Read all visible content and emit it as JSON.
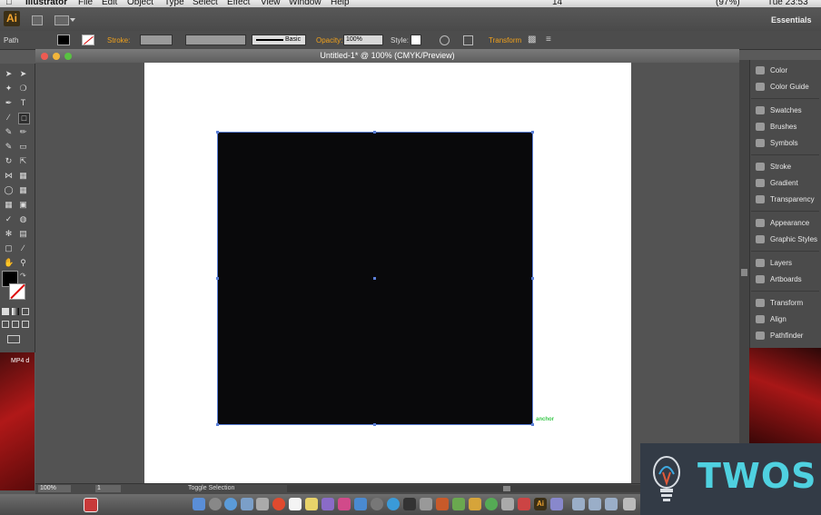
{
  "menubar": {
    "app_name": "Illustrator",
    "items": [
      "File",
      "Edit",
      "Object",
      "Type",
      "Select",
      "Effect",
      "View",
      "Window",
      "Help"
    ],
    "status": "14",
    "battery": "(97%)",
    "clock": "Tue 23:53"
  },
  "appbar": {
    "logo": "Ai",
    "workspace": "Essentials"
  },
  "control": {
    "selection_label": "Path",
    "stroke_label": "Stroke:",
    "brush_label": "Basic",
    "opacity_label": "Opacity:",
    "opacity_value": "100%",
    "style_label": "Style:",
    "transform_label": "Transform"
  },
  "document": {
    "title": "Untitled-1* @ 100% (CMYK/Preview)",
    "anchor_label": "anchor"
  },
  "statusbar": {
    "zoom": "100%",
    "page": "1",
    "toggle": "Toggle Selection"
  },
  "panels": [
    {
      "label": "Color",
      "icon": "color-icon"
    },
    {
      "label": "Color Guide",
      "icon": "color-guide-icon"
    },
    {
      "label": "Swatches",
      "icon": "swatches-icon"
    },
    {
      "label": "Brushes",
      "icon": "brushes-icon"
    },
    {
      "label": "Symbols",
      "icon": "symbols-icon"
    },
    {
      "label": "Stroke",
      "icon": "stroke-icon"
    },
    {
      "label": "Gradient",
      "icon": "gradient-icon"
    },
    {
      "label": "Transparency",
      "icon": "transparency-icon"
    },
    {
      "label": "Appearance",
      "icon": "appearance-icon"
    },
    {
      "label": "Graphic Styles",
      "icon": "graphic-styles-icon"
    },
    {
      "label": "Layers",
      "icon": "layers-icon"
    },
    {
      "label": "Artboards",
      "icon": "artboards-icon"
    },
    {
      "label": "Transform",
      "icon": "transform-icon"
    },
    {
      "label": "Align",
      "icon": "align-icon"
    },
    {
      "label": "Pathfinder",
      "icon": "pathfinder-icon"
    }
  ],
  "desktop": {
    "file_label": "MP4 d"
  },
  "watermark": {
    "text": "TWOS"
  },
  "colors": {
    "accent": "#f0a11c",
    "selection": "#5b7fd6",
    "watermark": "#4fd1e0",
    "anchor": "#39c84a"
  }
}
